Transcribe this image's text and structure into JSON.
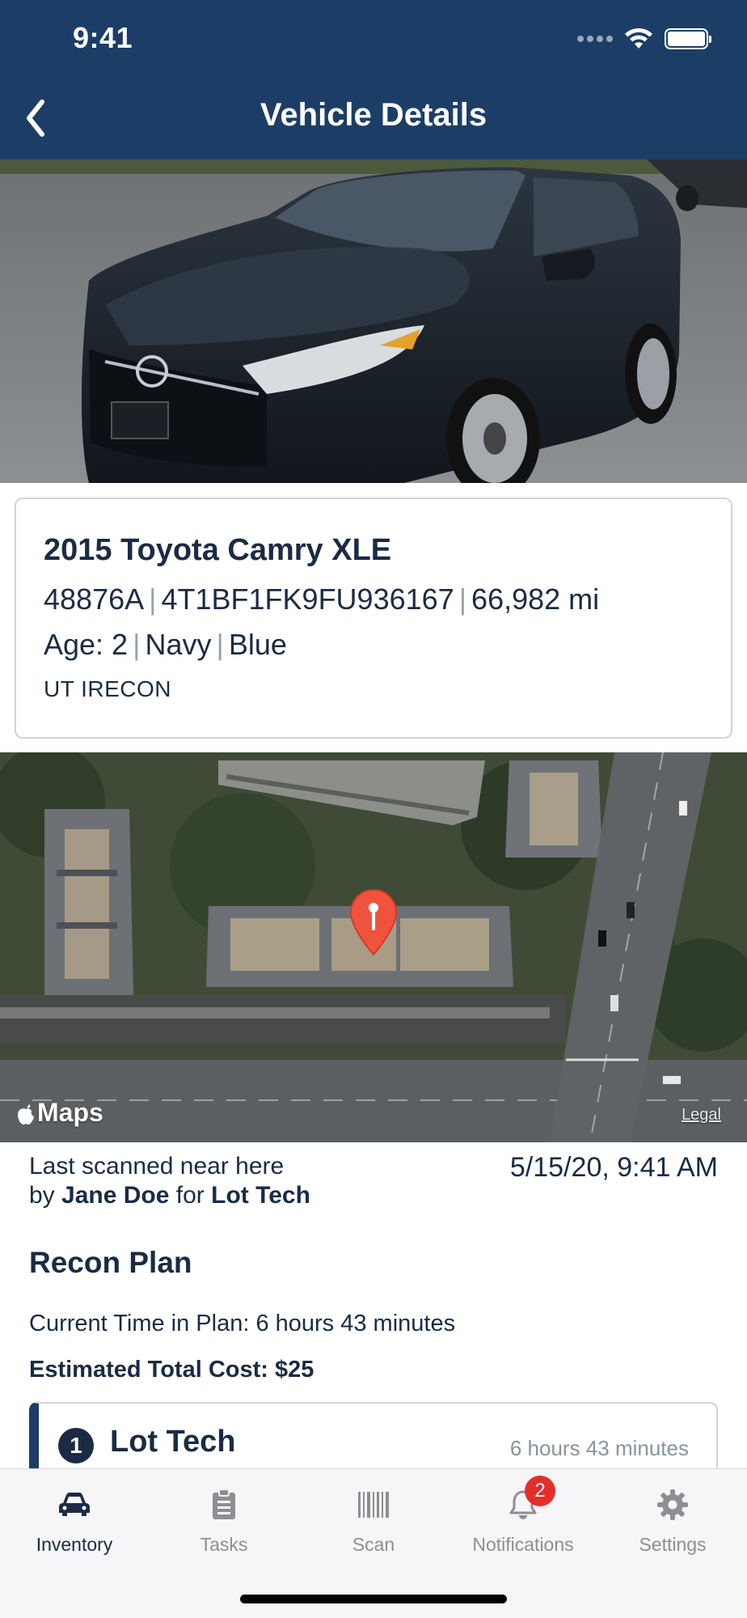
{
  "status_bar": {
    "time": "9:41"
  },
  "header": {
    "title": "Vehicle Details",
    "back_icon": "chevron-left-icon"
  },
  "vehicle": {
    "title": "2015 Toyota Camry XLE",
    "stock": "48876A",
    "vin": "4T1BF1FK9FU936167",
    "mileage": "66,982 mi",
    "age": "Age: 2",
    "exterior": "Navy",
    "interior": "Blue",
    "status": "UT IRECON"
  },
  "map": {
    "logo": "Maps",
    "legal": "Legal",
    "pin_color": "#f0533d"
  },
  "scan": {
    "prefix": "Last scanned near here",
    "by": "by",
    "user": "Jane Doe",
    "for": "for",
    "org": "Lot Tech",
    "date": "5/15/20, 9:41 AM"
  },
  "recon": {
    "title": "Recon Plan",
    "current_time": "Current Time in Plan: 6 hours 43 minutes",
    "total_cost": "Estimated Total Cost: $25",
    "steps": [
      {
        "number": "1",
        "name": "Lot Tech",
        "time": "6 hours 43 minutes"
      }
    ]
  },
  "tabbar": {
    "active_color": "#1b2b44",
    "inactive_color": "#8e8e93",
    "tabs": [
      {
        "label": "Inventory",
        "icon": "car-icon",
        "active": true
      },
      {
        "label": "Tasks",
        "icon": "clipboard-icon",
        "active": false
      },
      {
        "label": "Scan",
        "icon": "barcode-icon",
        "active": false
      },
      {
        "label": "Notifications",
        "icon": "bell-icon",
        "active": false,
        "badge": "2"
      },
      {
        "label": "Settings",
        "icon": "gear-icon",
        "active": false
      }
    ]
  }
}
